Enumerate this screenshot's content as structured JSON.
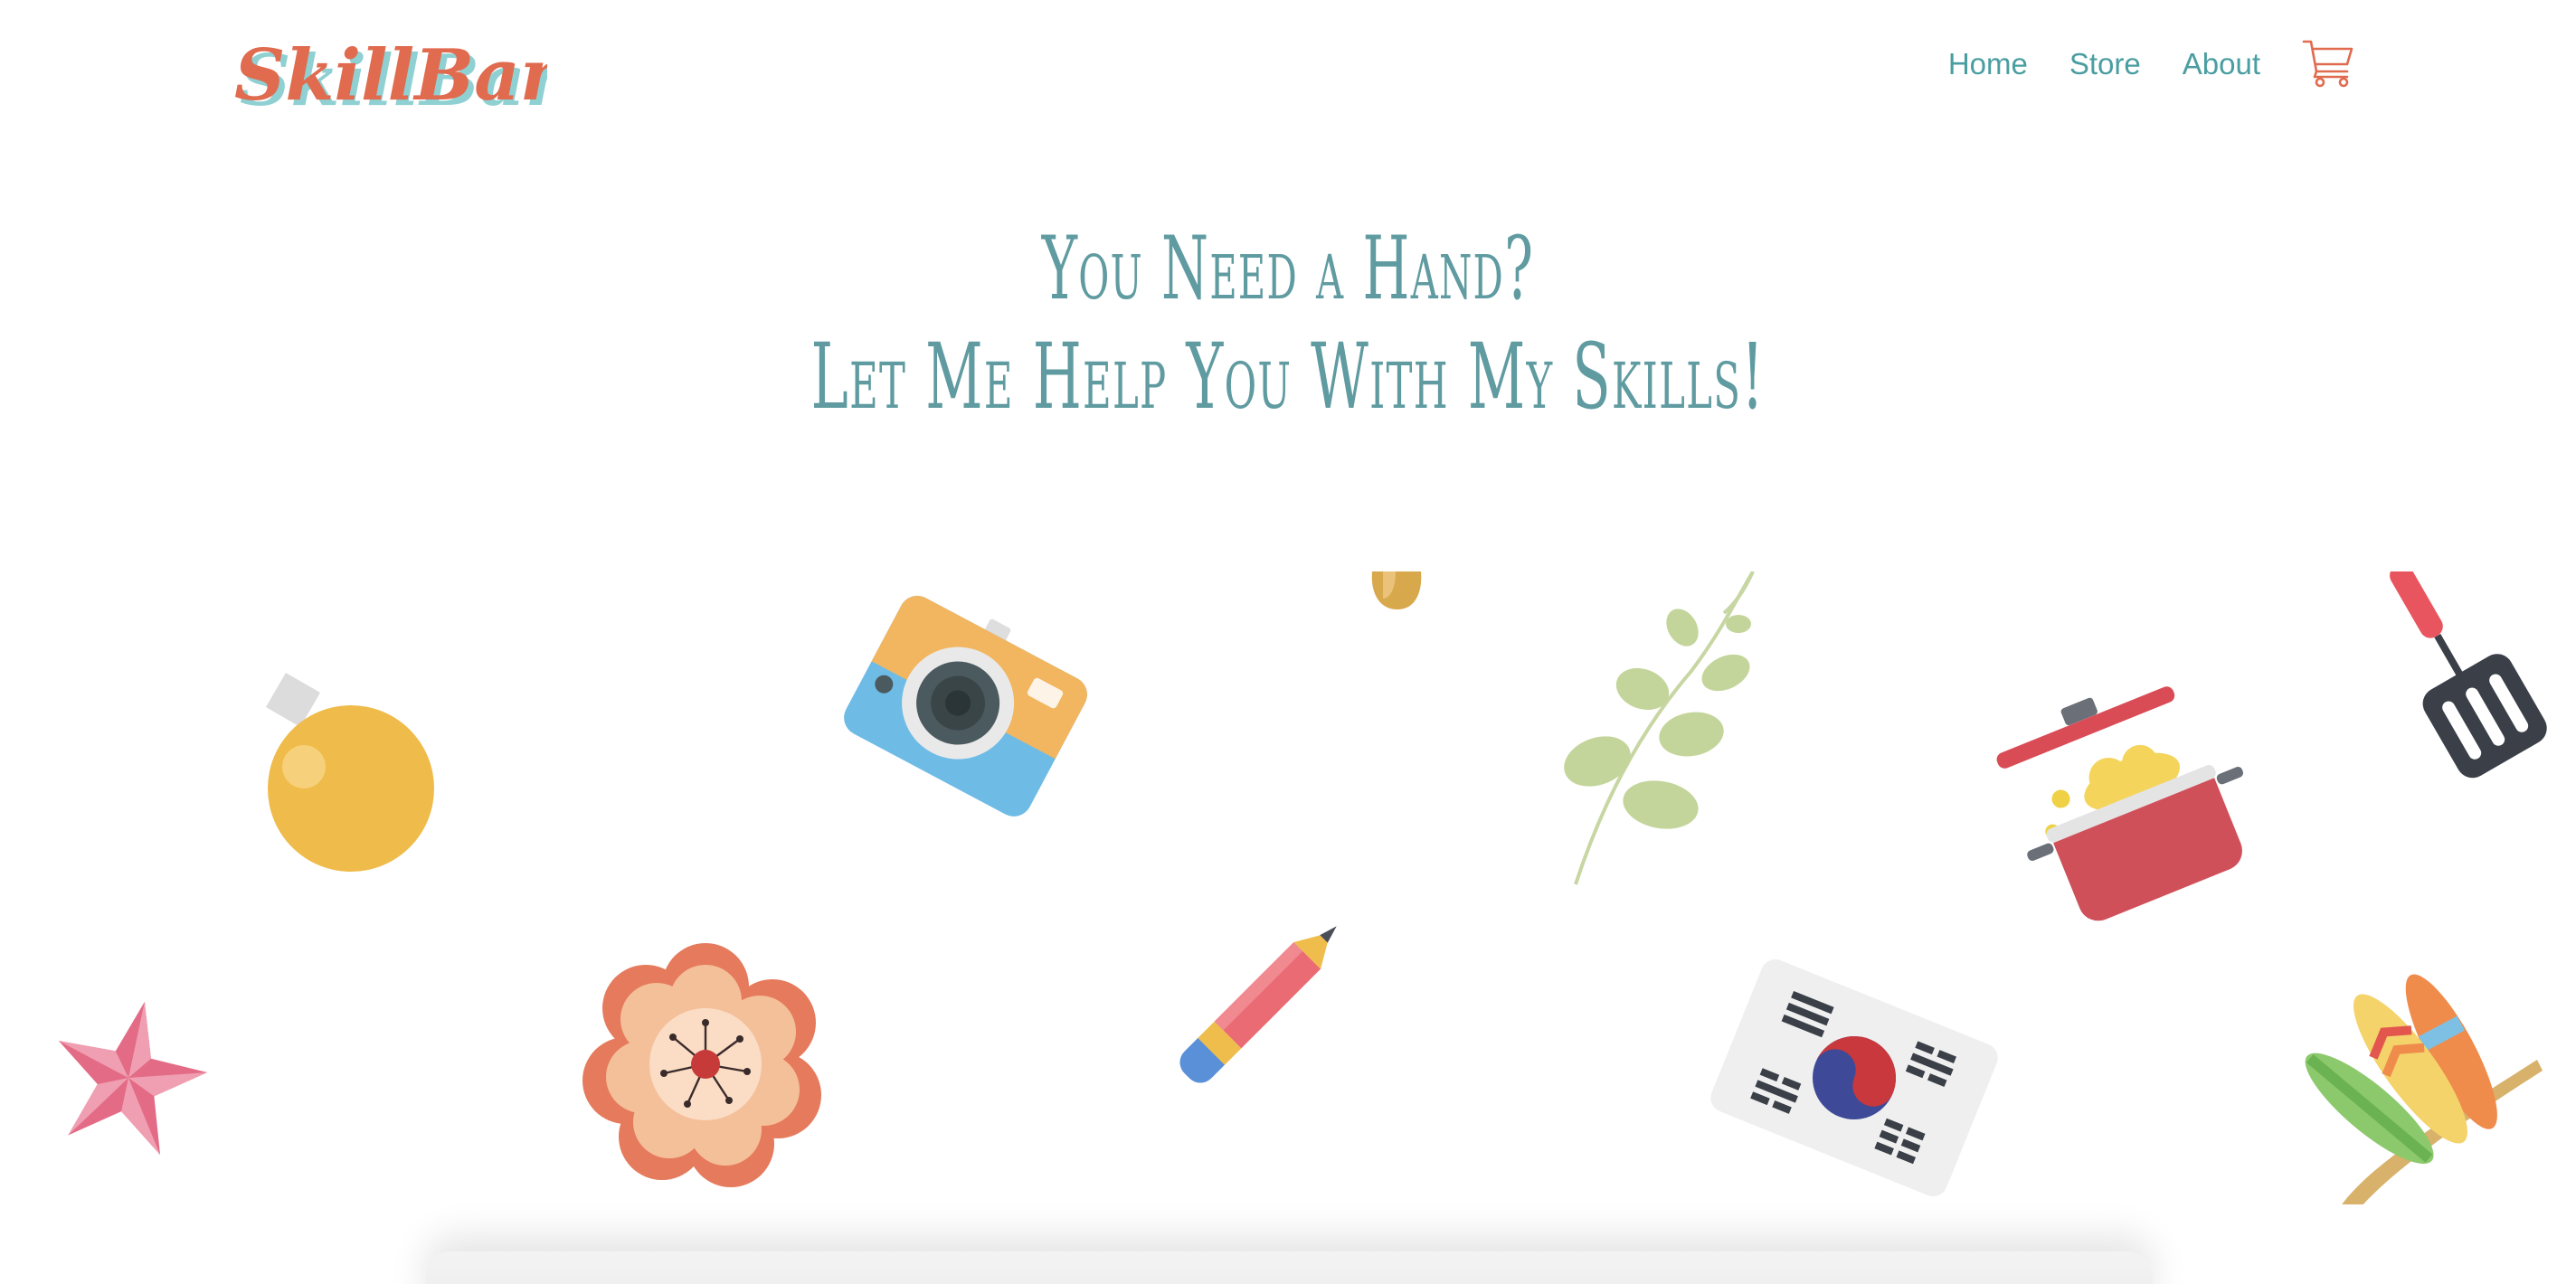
{
  "brand": {
    "logo_text": "SkillBank",
    "logo_color": "#e06b4f",
    "logo_shadow_color": "#8fd0d2"
  },
  "nav": {
    "items": [
      {
        "label": "Home"
      },
      {
        "label": "Store"
      },
      {
        "label": "About"
      }
    ],
    "cart_icon": "shopping-cart-icon",
    "link_color": "#4a9ea1",
    "cart_color": "#e06b4f"
  },
  "hero": {
    "line1": "You Need a Hand?",
    "line2": "Let Me Help You With My Skills!",
    "color": "#5f9ba0"
  },
  "illustrations": [
    "christmas-ornament-icon",
    "camera-icon",
    "yellow-blob-icon",
    "leaf-branch-icon",
    "cooking-pot-icon",
    "spatula-icon",
    "star-icon",
    "flower-icon",
    "pencil-icon",
    "korean-flag-icon",
    "surfboards-icon"
  ]
}
